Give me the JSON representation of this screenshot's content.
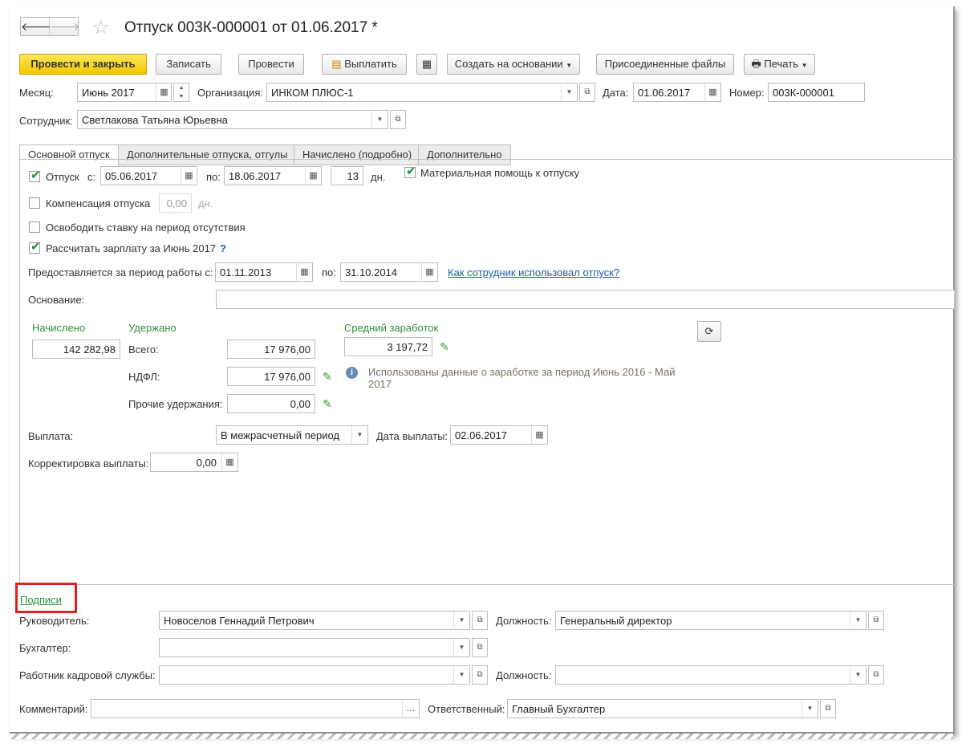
{
  "window": {
    "title": "Отпуск 003К-000001 от 01.06.2017 *"
  },
  "nav": {
    "back": "🡐",
    "forward": "🡒",
    "star": "☆"
  },
  "toolbar": {
    "post_close": "Провести и закрыть",
    "save": "Записать",
    "post": "Провести",
    "pay": "Выплатить",
    "create_based": "Создать на основании",
    "attached": "Присоединенные файлы",
    "print": "Печать"
  },
  "header": {
    "month_label": "Месяц:",
    "month": "Июнь 2017",
    "org_label": "Организация:",
    "org": "ИНКОМ ПЛЮС-1",
    "date_label": "Дата:",
    "date": "01.06.2017",
    "number_label": "Номер:",
    "number": "003К-000001",
    "employee_label": "Сотрудник:",
    "employee": "Светлакова Татьяна Юрьевна"
  },
  "tabs": [
    {
      "label": "Основной отпуск"
    },
    {
      "label": "Дополнительные отпуска, отгулы"
    },
    {
      "label": "Начислено (подробно)"
    },
    {
      "label": "Дополнительно"
    }
  ],
  "main": {
    "vac_label": "Отпуск",
    "from_label": "с:",
    "vac_from": "05.06.2017",
    "to_label": "по:",
    "vac_to": "18.06.2017",
    "days": "13",
    "days_unit": "дн.",
    "mat_help": "Материальная помощь к отпуску",
    "comp_label": "Компенсация отпуска",
    "comp_value": "0,00",
    "comp_unit": "дн.",
    "free_rate": "Освободить ставку на период отсутствия",
    "calc_salary": "Рассчитать зарплату за Июнь 2017",
    "help": "?",
    "period_label": "Предоставляется за период работы с:",
    "period_from": "01.11.2013",
    "period_to_label": "по:",
    "period_to": "31.10.2014",
    "used_link": "Как сотрудник использовал отпуск?",
    "basis_label": "Основание:",
    "basis": "",
    "accrued_label": "Начислено",
    "accrued": "142 282,98",
    "withheld_label": "Удержано",
    "total_label": "Всего:",
    "total": "17 976,00",
    "ndfl_label": "НДФЛ:",
    "ndfl": "17 976,00",
    "other_label": "Прочие удержания:",
    "other": "0,00",
    "avg_label": "Средний заработок",
    "avg": "3 197,72",
    "info": "Использованы данные о заработке за период Июнь 2016 - Май 2017",
    "payment_label": "Выплата:",
    "payment": "В межрасчетный период",
    "paydate_label": "Дата выплаты:",
    "paydate": "02.06.2017",
    "adjust_label": "Корректировка выплаты:",
    "adjust": "0,00"
  },
  "signatures": {
    "title": "Подписи",
    "head_label": "Руководитель:",
    "head": "Новоселов Геннадий Петрович",
    "pos_label": "Должность:",
    "head_pos": "Генеральный директор",
    "acc_label": "Бухгалтер:",
    "acc": "",
    "hr_label": "Работник кадровой службы:",
    "hr": "",
    "hr_pos": ""
  },
  "footer": {
    "comment_label": "Комментарий:",
    "comment": "",
    "resp_label": "Ответственный:",
    "resp": "Главный Бухгалтер"
  },
  "colors": {
    "primary": "#f7d31a",
    "green": "#2c8c3c",
    "link": "#1a5fb4",
    "highlight": "#e02020"
  }
}
